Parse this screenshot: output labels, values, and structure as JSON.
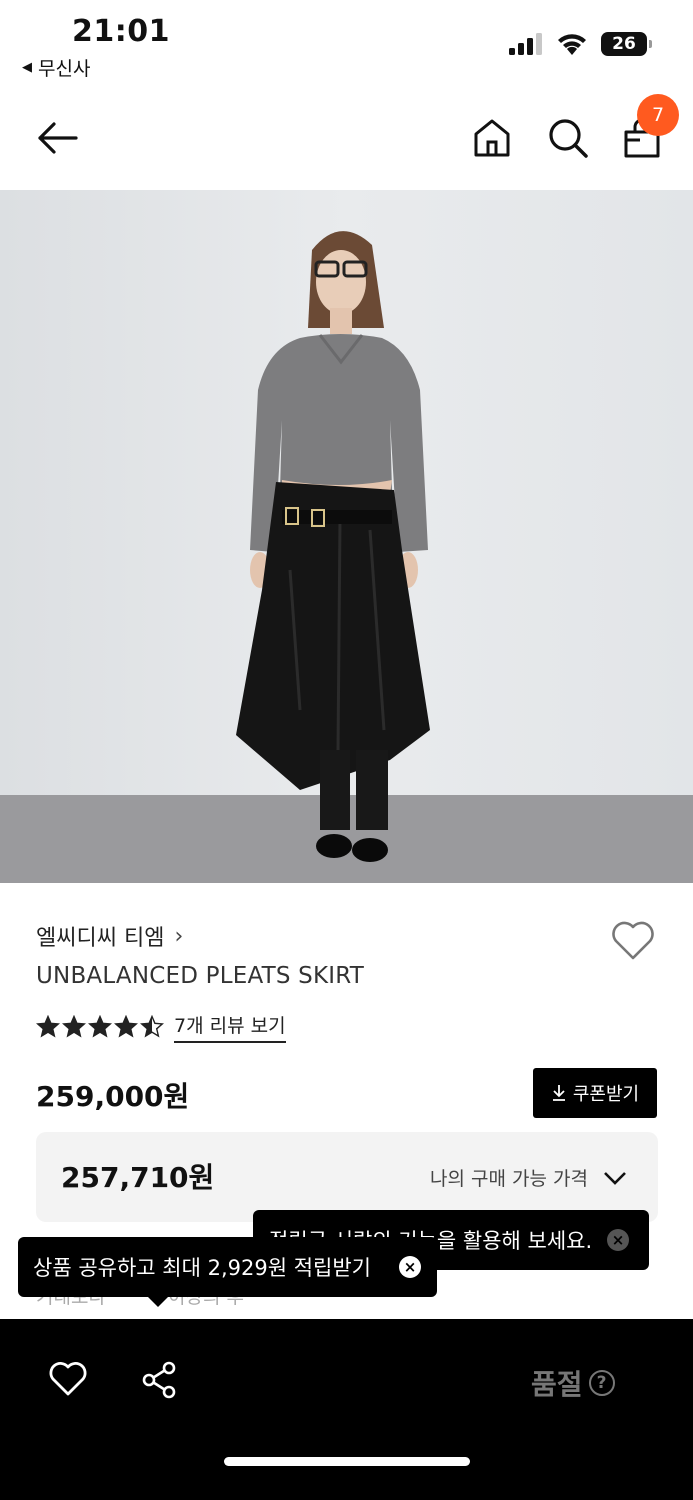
{
  "status_bar": {
    "time": "21:01",
    "back_app": "무신사",
    "battery": "26",
    "icons": [
      "signal-icon",
      "wifi-icon",
      "battery-icon"
    ]
  },
  "nav": {
    "icons": [
      "back-arrow-icon",
      "home-icon",
      "search-icon",
      "shopping-bag-icon"
    ],
    "cart_count": "7"
  },
  "product": {
    "image_alt": "model wearing grey v-neck sweater and black unbalanced pleats skirt",
    "brand": "엘씨디씨 티엠",
    "brand_chevron": "›",
    "name": "UNBALANCED PLEATS SKIRT",
    "rating": 4.5,
    "rating_max": 5,
    "review_link": "7개 리뷰 보기",
    "price": "259,000원",
    "coupon_button": "쿠폰받기",
    "my_price": "257,710원",
    "my_price_label": "나의 구매 가능 가격"
  },
  "tooltips": {
    "right": "적립금 서랍의 기능을 활용해 보세요.",
    "left": "상품 공유하고 최대 2,929원 적립받기",
    "close": "×"
  },
  "obscured": {
    "left": "기대보다",
    "right": "이상의 후"
  },
  "bottom_bar": {
    "status": "품절",
    "help": "?"
  },
  "colors": {
    "badge": "#ff5a1f",
    "bottom_bar": "#000000",
    "price_box": "#f3f3f3"
  }
}
